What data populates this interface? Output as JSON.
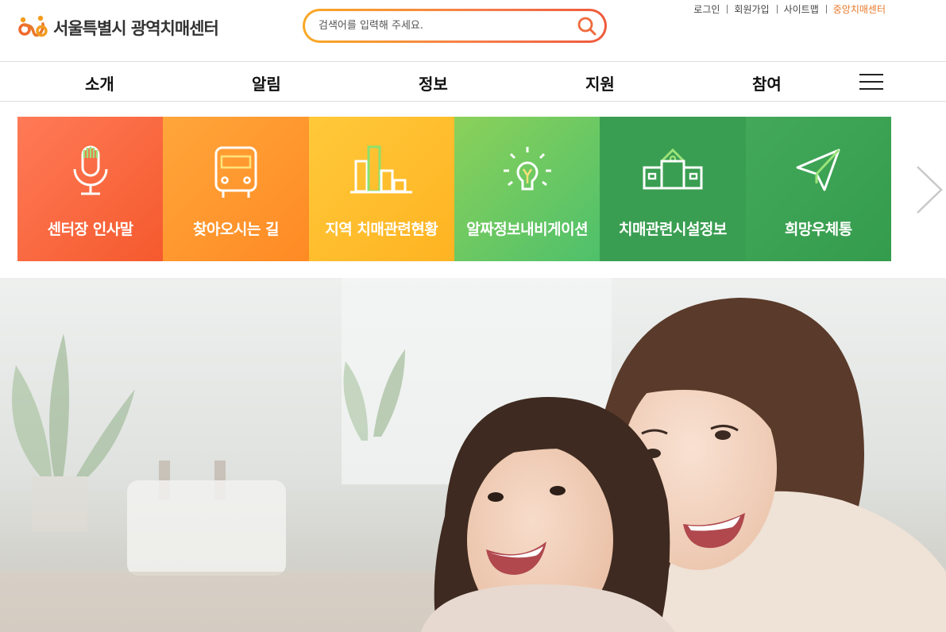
{
  "header": {
    "logo_text": "서울특별시 광역치매센터",
    "search": {
      "placeholder": "검색어를 입력해 주세요."
    },
    "util_links": [
      "로그인",
      "회원가입",
      "사이트맵",
      "중앙치매센터"
    ]
  },
  "nav": {
    "items": [
      "소개",
      "알림",
      "정보",
      "지원",
      "참여"
    ]
  },
  "tiles": [
    {
      "label": "센터장 인사말",
      "icon": "microphone-icon"
    },
    {
      "label": "찾아오시는 길",
      "icon": "bus-icon"
    },
    {
      "label": "지역 치매관련현황",
      "icon": "bar-chart-icon"
    },
    {
      "label": "알짜정보내비게이션",
      "icon": "lightbulb-icon"
    },
    {
      "label": "치매관련시설정보",
      "icon": "building-icon"
    },
    {
      "label": "희망우체통",
      "icon": "paper-plane-icon"
    }
  ],
  "colors": {
    "accent_orange": "#e8782a",
    "tile_green": "#3a9e52"
  }
}
